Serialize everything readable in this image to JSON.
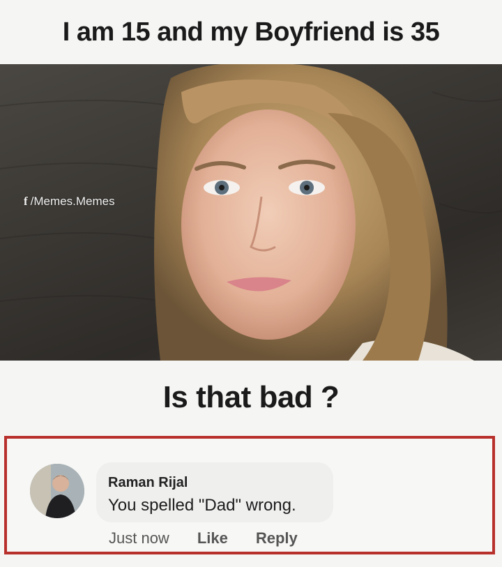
{
  "top_caption": "I am 15 and my Boyfriend is 35",
  "photo": {
    "watermark_icon": "facebook-f-icon",
    "watermark_text": "/Memes.Memes"
  },
  "mid_caption": "Is that bad ?",
  "comment": {
    "author": "Raman Rijal",
    "text": "You spelled \"Dad\" wrong.",
    "timestamp": "Just now",
    "like_label": "Like",
    "reply_label": "Reply",
    "highlight_color": "#b8302c"
  }
}
